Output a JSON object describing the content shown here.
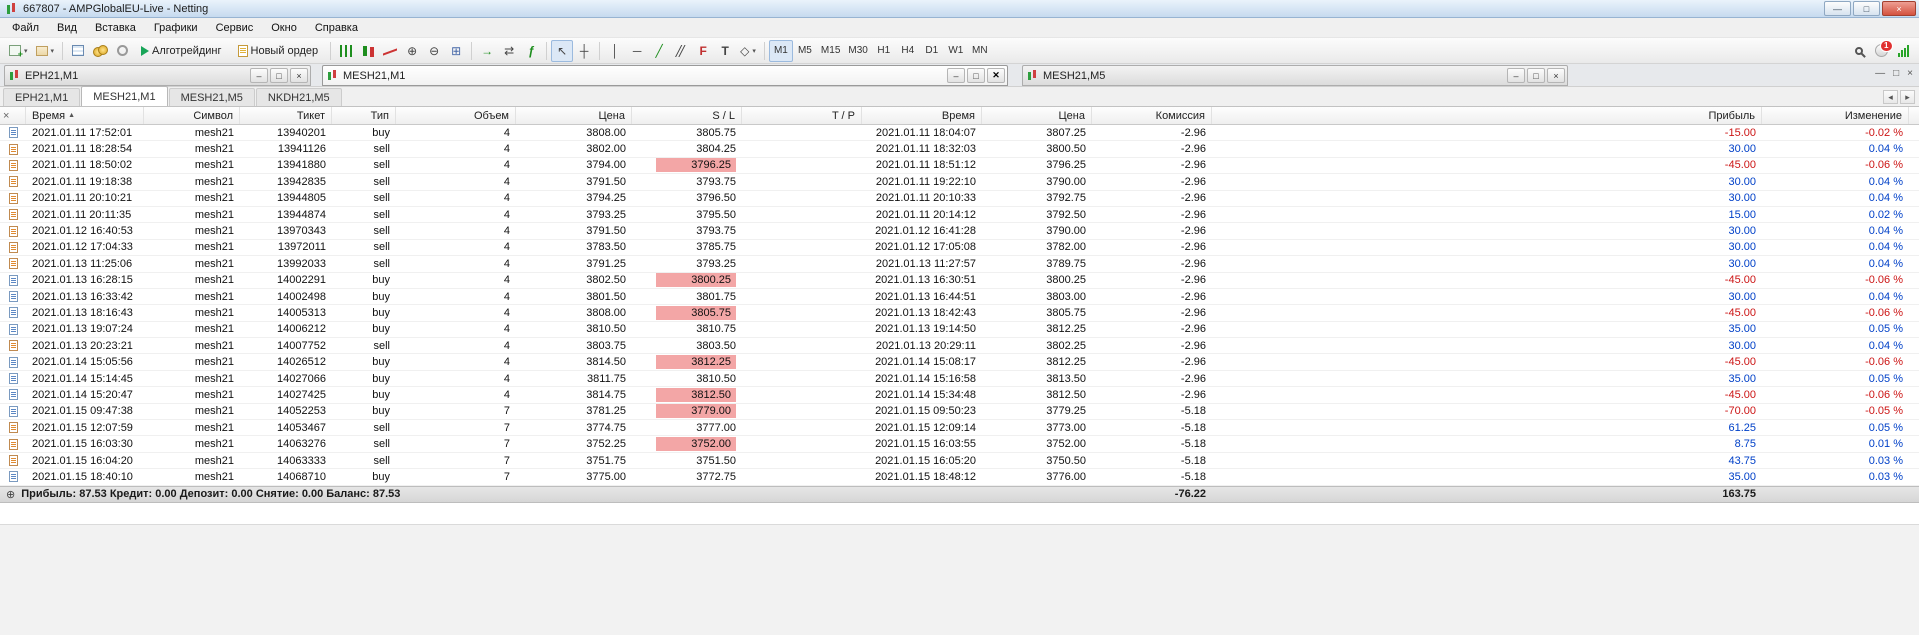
{
  "titlebar": {
    "title": "667807 - AMPGlobalEU-Live - Netting"
  },
  "menubar": {
    "items": [
      "Файл",
      "Вид",
      "Вставка",
      "Графики",
      "Сервис",
      "Окно",
      "Справка"
    ]
  },
  "toolbar": {
    "algotrading": "Алготрейдинг",
    "new_order": "Новый ордер",
    "timeframes": [
      "M1",
      "M5",
      "M15",
      "M30",
      "H1",
      "H4",
      "D1",
      "W1",
      "MN"
    ],
    "active_timeframe": "M1",
    "notification_badge": "1"
  },
  "mdi": {
    "windows": [
      {
        "title": "EPH21,M1"
      },
      {
        "title": "MESH21,M1"
      },
      {
        "title": "MESH21,M5"
      }
    ]
  },
  "tabs": {
    "items": [
      "EPH21,M1",
      "MESH21,M1",
      "MESH21,M5",
      "NKDH21,M5"
    ],
    "active": "MESH21,M1"
  },
  "history": {
    "headers": {
      "time": "Время",
      "symbol": "Символ",
      "ticket": "Тикет",
      "type": "Тип",
      "volume": "Объем",
      "price": "Цена",
      "sl": "S / L",
      "tp": "T / P",
      "close_time": "Время",
      "close_price": "Цена",
      "commission": "Комиссия",
      "profit": "Прибыль",
      "change": "Изменение"
    },
    "rows": [
      {
        "time": "2021.01.11 17:52:01",
        "symbol": "mesh21",
        "ticket": "13940201",
        "type": "buy",
        "volume": "4",
        "price": "3808.00",
        "sl": "3805.75",
        "sl_hit": false,
        "tp": "",
        "close_time": "2021.01.11 18:04:07",
        "close_price": "3807.25",
        "commission": "-2.96",
        "profit": "-15.00",
        "change": "-0.02 %"
      },
      {
        "time": "2021.01.11 18:28:54",
        "symbol": "mesh21",
        "ticket": "13941126",
        "type": "sell",
        "volume": "4",
        "price": "3802.00",
        "sl": "3804.25",
        "sl_hit": false,
        "tp": "",
        "close_time": "2021.01.11 18:32:03",
        "close_price": "3800.50",
        "commission": "-2.96",
        "profit": "30.00",
        "change": "0.04 %"
      },
      {
        "time": "2021.01.11 18:50:02",
        "symbol": "mesh21",
        "ticket": "13941880",
        "type": "sell",
        "volume": "4",
        "price": "3794.00",
        "sl": "3796.25",
        "sl_hit": true,
        "tp": "",
        "close_time": "2021.01.11 18:51:12",
        "close_price": "3796.25",
        "commission": "-2.96",
        "profit": "-45.00",
        "change": "-0.06 %"
      },
      {
        "time": "2021.01.11 19:18:38",
        "symbol": "mesh21",
        "ticket": "13942835",
        "type": "sell",
        "volume": "4",
        "price": "3791.50",
        "sl": "3793.75",
        "sl_hit": false,
        "tp": "",
        "close_time": "2021.01.11 19:22:10",
        "close_price": "3790.00",
        "commission": "-2.96",
        "profit": "30.00",
        "change": "0.04 %"
      },
      {
        "time": "2021.01.11 20:10:21",
        "symbol": "mesh21",
        "ticket": "13944805",
        "type": "sell",
        "volume": "4",
        "price": "3794.25",
        "sl": "3796.50",
        "sl_hit": false,
        "tp": "",
        "close_time": "2021.01.11 20:10:33",
        "close_price": "3792.75",
        "commission": "-2.96",
        "profit": "30.00",
        "change": "0.04 %"
      },
      {
        "time": "2021.01.11 20:11:35",
        "symbol": "mesh21",
        "ticket": "13944874",
        "type": "sell",
        "volume": "4",
        "price": "3793.25",
        "sl": "3795.50",
        "sl_hit": false,
        "tp": "",
        "close_time": "2021.01.11 20:14:12",
        "close_price": "3792.50",
        "commission": "-2.96",
        "profit": "15.00",
        "change": "0.02 %"
      },
      {
        "time": "2021.01.12 16:40:53",
        "symbol": "mesh21",
        "ticket": "13970343",
        "type": "sell",
        "volume": "4",
        "price": "3791.50",
        "sl": "3793.75",
        "sl_hit": false,
        "tp": "",
        "close_time": "2021.01.12 16:41:28",
        "close_price": "3790.00",
        "commission": "-2.96",
        "profit": "30.00",
        "change": "0.04 %"
      },
      {
        "time": "2021.01.12 17:04:33",
        "symbol": "mesh21",
        "ticket": "13972011",
        "type": "sell",
        "volume": "4",
        "price": "3783.50",
        "sl": "3785.75",
        "sl_hit": false,
        "tp": "",
        "close_time": "2021.01.12 17:05:08",
        "close_price": "3782.00",
        "commission": "-2.96",
        "profit": "30.00",
        "change": "0.04 %"
      },
      {
        "time": "2021.01.13 11:25:06",
        "symbol": "mesh21",
        "ticket": "13992033",
        "type": "sell",
        "volume": "4",
        "price": "3791.25",
        "sl": "3793.25",
        "sl_hit": false,
        "tp": "",
        "close_time": "2021.01.13 11:27:57",
        "close_price": "3789.75",
        "commission": "-2.96",
        "profit": "30.00",
        "change": "0.04 %"
      },
      {
        "time": "2021.01.13 16:28:15",
        "symbol": "mesh21",
        "ticket": "14002291",
        "type": "buy",
        "volume": "4",
        "price": "3802.50",
        "sl": "3800.25",
        "sl_hit": true,
        "tp": "",
        "close_time": "2021.01.13 16:30:51",
        "close_price": "3800.25",
        "commission": "-2.96",
        "profit": "-45.00",
        "change": "-0.06 %"
      },
      {
        "time": "2021.01.13 16:33:42",
        "symbol": "mesh21",
        "ticket": "14002498",
        "type": "buy",
        "volume": "4",
        "price": "3801.50",
        "sl": "3801.75",
        "sl_hit": false,
        "tp": "",
        "close_time": "2021.01.13 16:44:51",
        "close_price": "3803.00",
        "commission": "-2.96",
        "profit": "30.00",
        "change": "0.04 %"
      },
      {
        "time": "2021.01.13 18:16:43",
        "symbol": "mesh21",
        "ticket": "14005313",
        "type": "buy",
        "volume": "4",
        "price": "3808.00",
        "sl": "3805.75",
        "sl_hit": true,
        "tp": "",
        "close_time": "2021.01.13 18:42:43",
        "close_price": "3805.75",
        "commission": "-2.96",
        "profit": "-45.00",
        "change": "-0.06 %"
      },
      {
        "time": "2021.01.13 19:07:24",
        "symbol": "mesh21",
        "ticket": "14006212",
        "type": "buy",
        "volume": "4",
        "price": "3810.50",
        "sl": "3810.75",
        "sl_hit": false,
        "tp": "",
        "close_time": "2021.01.13 19:14:50",
        "close_price": "3812.25",
        "commission": "-2.96",
        "profit": "35.00",
        "change": "0.05 %"
      },
      {
        "time": "2021.01.13 20:23:21",
        "symbol": "mesh21",
        "ticket": "14007752",
        "type": "sell",
        "volume": "4",
        "price": "3803.75",
        "sl": "3803.50",
        "sl_hit": false,
        "tp": "",
        "close_time": "2021.01.13 20:29:11",
        "close_price": "3802.25",
        "commission": "-2.96",
        "profit": "30.00",
        "change": "0.04 %"
      },
      {
        "time": "2021.01.14 15:05:56",
        "symbol": "mesh21",
        "ticket": "14026512",
        "type": "buy",
        "volume": "4",
        "price": "3814.50",
        "sl": "3812.25",
        "sl_hit": true,
        "tp": "",
        "close_time": "2021.01.14 15:08:17",
        "close_price": "3812.25",
        "commission": "-2.96",
        "profit": "-45.00",
        "change": "-0.06 %"
      },
      {
        "time": "2021.01.14 15:14:45",
        "symbol": "mesh21",
        "ticket": "14027066",
        "type": "buy",
        "volume": "4",
        "price": "3811.75",
        "sl": "3810.50",
        "sl_hit": false,
        "tp": "",
        "close_time": "2021.01.14 15:16:58",
        "close_price": "3813.50",
        "commission": "-2.96",
        "profit": "35.00",
        "change": "0.05 %"
      },
      {
        "time": "2021.01.14 15:20:47",
        "symbol": "mesh21",
        "ticket": "14027425",
        "type": "buy",
        "volume": "4",
        "price": "3814.75",
        "sl": "3812.50",
        "sl_hit": true,
        "tp": "",
        "close_time": "2021.01.14 15:34:48",
        "close_price": "3812.50",
        "commission": "-2.96",
        "profit": "-45.00",
        "change": "-0.06 %"
      },
      {
        "time": "2021.01.15 09:47:38",
        "symbol": "mesh21",
        "ticket": "14052253",
        "type": "buy",
        "volume": "7",
        "price": "3781.25",
        "sl": "3779.00",
        "sl_hit": true,
        "tp": "",
        "close_time": "2021.01.15 09:50:23",
        "close_price": "3779.25",
        "commission": "-5.18",
        "profit": "-70.00",
        "change": "-0.05 %"
      },
      {
        "time": "2021.01.15 12:07:59",
        "symbol": "mesh21",
        "ticket": "14053467",
        "type": "sell",
        "volume": "7",
        "price": "3774.75",
        "sl": "3777.00",
        "sl_hit": false,
        "tp": "",
        "close_time": "2021.01.15 12:09:14",
        "close_price": "3773.00",
        "commission": "-5.18",
        "profit": "61.25",
        "change": "0.05 %"
      },
      {
        "time": "2021.01.15 16:03:30",
        "symbol": "mesh21",
        "ticket": "14063276",
        "type": "sell",
        "volume": "7",
        "price": "3752.25",
        "sl": "3752.00",
        "sl_hit": true,
        "tp": "",
        "close_time": "2021.01.15 16:03:55",
        "close_price": "3752.00",
        "commission": "-5.18",
        "profit": "8.75",
        "change": "0.01 %"
      },
      {
        "time": "2021.01.15 16:04:20",
        "symbol": "mesh21",
        "ticket": "14063333",
        "type": "sell",
        "volume": "7",
        "price": "3751.75",
        "sl": "3751.50",
        "sl_hit": false,
        "tp": "",
        "close_time": "2021.01.15 16:05:20",
        "close_price": "3750.50",
        "commission": "-5.18",
        "profit": "43.75",
        "change": "0.03 %"
      },
      {
        "time": "2021.01.15 18:40:10",
        "symbol": "mesh21",
        "ticket": "14068710",
        "type": "buy",
        "volume": "7",
        "price": "3775.00",
        "sl": "3772.75",
        "sl_hit": false,
        "tp": "",
        "close_time": "2021.01.15 18:48:12",
        "close_price": "3776.00",
        "commission": "-5.18",
        "profit": "35.00",
        "change": "0.03 %"
      }
    ],
    "footer": {
      "summary": "Прибыль: 87.53  Кредит: 0.00  Депозит: 0.00  Снятие: 0.00  Баланс: 87.53",
      "commission_total": "-76.22",
      "profit_total": "163.75"
    }
  },
  "colors": {
    "profit_pos": "#0040c8",
    "profit_neg": "#cc1515",
    "sl_hit_bg": "#f3a6a6"
  }
}
